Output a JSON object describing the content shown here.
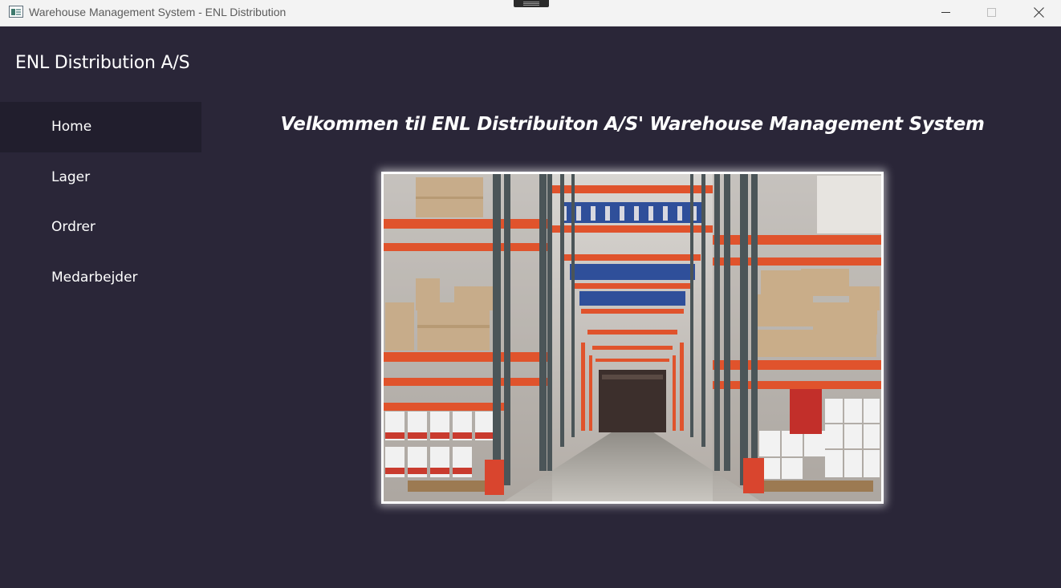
{
  "window": {
    "title": "Warehouse Management System - ENL Distribution",
    "icons": {
      "app": "app-icon",
      "minimize": "minimize-icon",
      "maximize": "maximize-icon",
      "close": "close-icon"
    }
  },
  "sidebar": {
    "brand": "ENL Distribution A/S",
    "items": [
      {
        "label": "Home",
        "active": true
      },
      {
        "label": "Lager",
        "active": false
      },
      {
        "label": "Ordrer",
        "active": false
      },
      {
        "label": "Medarbejder",
        "active": false
      }
    ]
  },
  "main": {
    "headline": "Velkommen til ENL Distribuiton A/S' Warehouse Management System",
    "image": "warehouse-aisle-photo"
  },
  "colors": {
    "background": "#2a2638",
    "nav_active": "#211e2d",
    "text": "#ffffff",
    "rack_orange": "#e0532c"
  }
}
